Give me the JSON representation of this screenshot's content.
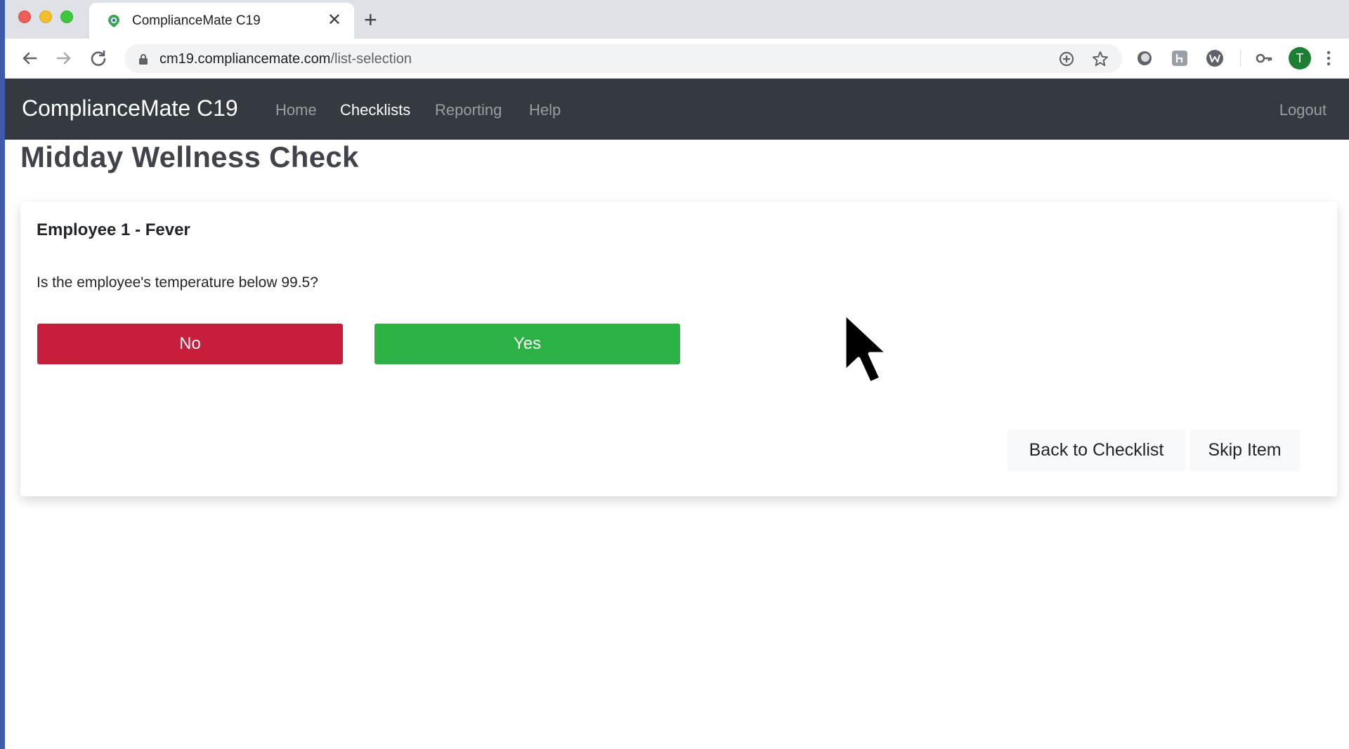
{
  "browser": {
    "tab_title": "ComplianceMate C19",
    "tab_close": "✕",
    "new_tab": "+",
    "url_host": "cm19.compliancemate.com",
    "url_path": "/list-selection",
    "avatar_letter": "T"
  },
  "navbar": {
    "brand": "ComplianceMate C19",
    "links": [
      "Home",
      "Checklists",
      "Reporting",
      "Help"
    ],
    "active": "Checklists",
    "logout": "Logout"
  },
  "page": {
    "title": "Midday Wellness Check"
  },
  "checklist_item": {
    "title": "Employee 1 - Fever",
    "question": "Is the employee's temperature below 99.5?",
    "no_label": "No",
    "yes_label": "Yes",
    "back_label": "Back to Checklist",
    "skip_label": "Skip Item"
  },
  "colors": {
    "navbar": "#343a40",
    "no": "#c81e3c",
    "yes": "#2bb144"
  }
}
